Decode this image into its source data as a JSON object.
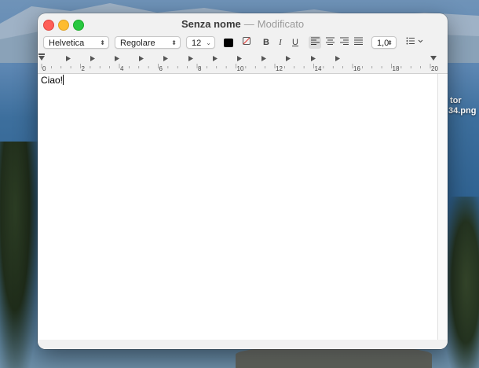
{
  "desktop": {
    "labels": [
      "tor",
      "34.png"
    ]
  },
  "window": {
    "title": "Senza nome",
    "separator": "—",
    "status": "Modificato"
  },
  "toolbar": {
    "font_family": "Helvetica",
    "font_style": "Regolare",
    "font_size": "12",
    "text_color": "#000000",
    "bold_label": "B",
    "italic_label": "I",
    "underline_label": "U",
    "line_spacing": "1,0"
  },
  "ruler": {
    "numbers": [
      "0",
      "2",
      "4",
      "6",
      "8",
      "10",
      "12",
      "14",
      "16",
      "18",
      "20"
    ]
  },
  "document": {
    "text": "Ciao!"
  }
}
